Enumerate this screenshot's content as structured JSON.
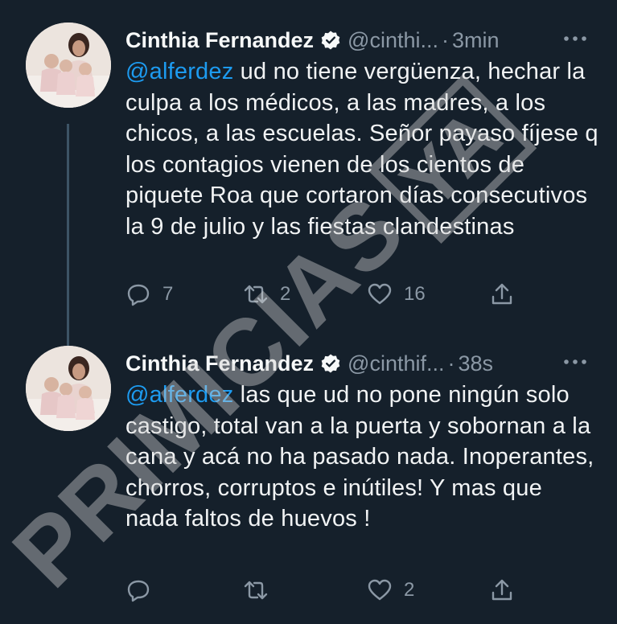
{
  "tweets": [
    {
      "author_name": "Cinthia Fernandez",
      "handle": "@cinthi...",
      "separator": "·",
      "time": "3min",
      "mention": "@alferdez",
      "text": " ud no tiene vergüenza, hechar la culpa a los médicos, a las madres, a los chicos, a las escuelas. Señor payaso fíjese q los contagios vienen de los cientos de piquete Roa que cortaron días consecutivos la 9 de julio y las fiestas clandestinas",
      "reply_count": "7",
      "retweet_count": "2",
      "like_count": "16"
    },
    {
      "author_name": "Cinthia Fernandez",
      "handle": "@cinthif...",
      "separator": "·",
      "time": "38s",
      "mention": "@alferdez",
      "text": " las que ud no pone ningún solo castigo, total van a la puerta y sobornan a la cana y acá no ha pasado nada. Inoperantes, chorros, corruptos e inútiles! Y mas que nada faltos de huevos !",
      "reply_count": "",
      "retweet_count": "",
      "like_count": "2"
    }
  ],
  "watermark": {
    "text": "PRIMICIAS",
    "box_text": "YA"
  },
  "icons": {
    "verified": "verified-badge-icon",
    "more": "more-icon",
    "reply": "reply-icon",
    "retweet": "retweet-icon",
    "like": "heart-icon",
    "share": "share-icon"
  },
  "colors": {
    "background": "#15202b",
    "mention": "#1d9bf0",
    "secondary_text": "#8b98a5"
  }
}
